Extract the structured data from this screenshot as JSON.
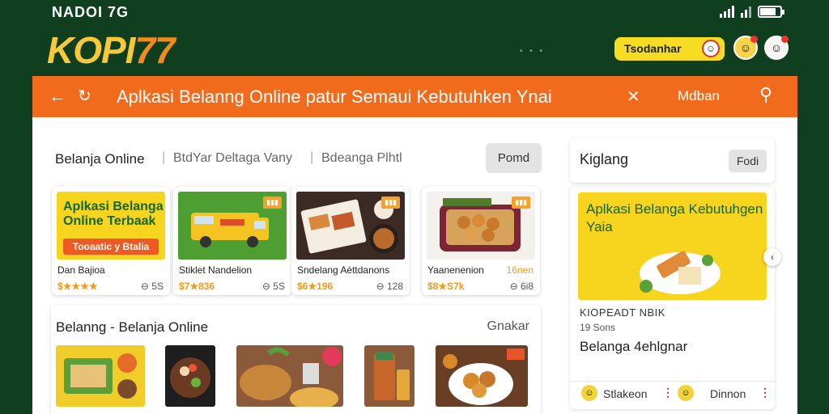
{
  "status": {
    "time": "NADOI 7G",
    "battery_percent": 80
  },
  "brand": {
    "logo_a": "KOPI",
    "logo_b": "77"
  },
  "header": {
    "promo_label": "Tsodanhar"
  },
  "nav": {
    "title": "Aplkasi Belanng Online patur Semaui Kebutuhken Ynai",
    "mode_label": "Mdban"
  },
  "tabs": [
    {
      "label": "Belanja Online"
    },
    {
      "label": "BtdYar Deltaga Vany"
    },
    {
      "label": "Bdeanga Plhtl"
    }
  ],
  "portal_button": "Pomd",
  "cards": [
    {
      "name": "Dan Bajioa",
      "price": "$★★★★",
      "count": "⊖ 5S",
      "banner_title": "Aplkasi Belanga Online Terbaak",
      "banner_btn": "Tooaatic y Btalia"
    },
    {
      "name": "Stiklet Nandelion",
      "price": "$7★836",
      "count": "⊖ 5S"
    },
    {
      "name": "Sndelang Aèttdanons",
      "price": "$6★196",
      "count": "⊖ 128"
    },
    {
      "name": "Yaanenenion",
      "price": "$8★S7k",
      "count": "⊖ 6i8",
      "extra": "16nen"
    }
  ],
  "section2": {
    "title": "Belanng - Belanja Online",
    "more": "Gnakar"
  },
  "right": {
    "title": "Kiglang",
    "filter_btn": "Fodi",
    "banner_title": "Aplkasi Belanga Kebutuhgen Yaia",
    "line1": "KIOPEADT NBIK",
    "line2": "19 Sons",
    "line3": "Belanga 4ehlgnar",
    "action1": "Stlakeon",
    "action2": "Dinnon"
  }
}
